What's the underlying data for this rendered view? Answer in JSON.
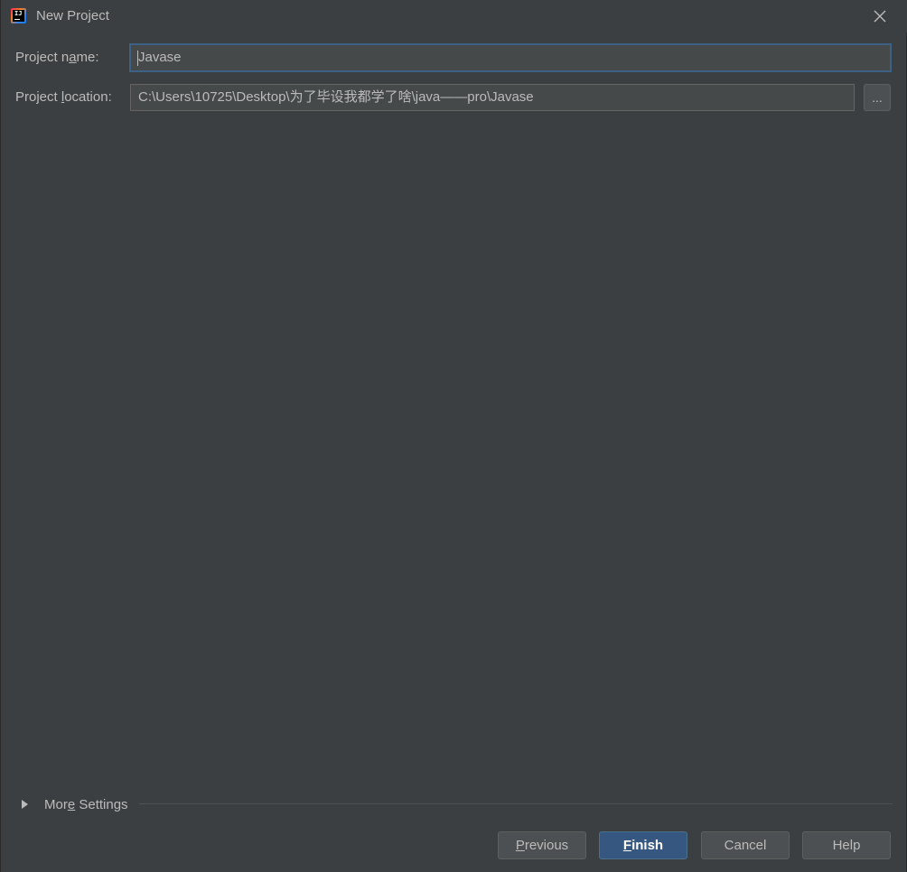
{
  "window": {
    "title": "New Project",
    "app_icon": "intellij-idea-icon"
  },
  "form": {
    "project_name": {
      "label_pre": "Project n",
      "label_mnemonic": "a",
      "label_post": "me:",
      "value": "Javase"
    },
    "project_location": {
      "label_pre": "Project ",
      "label_mnemonic": "l",
      "label_post": "ocation:",
      "value": "C:\\Users\\10725\\Desktop\\为了毕设我都学了啥\\java——pro\\Javase",
      "browse_label": "..."
    }
  },
  "more_settings": {
    "label_pre": "Mor",
    "label_mnemonic": "e",
    "label_post": " Settings",
    "expanded": false
  },
  "buttons": {
    "previous": {
      "mnemonic": "P",
      "rest": "revious"
    },
    "finish": {
      "mnemonic": "F",
      "rest": "inish"
    },
    "cancel": {
      "label": "Cancel"
    },
    "help": {
      "label": "Help"
    }
  },
  "colors": {
    "background": "#3c3f41",
    "focus_border": "#3d6185",
    "primary_button": "#365880",
    "text": "#bbbbbb"
  }
}
